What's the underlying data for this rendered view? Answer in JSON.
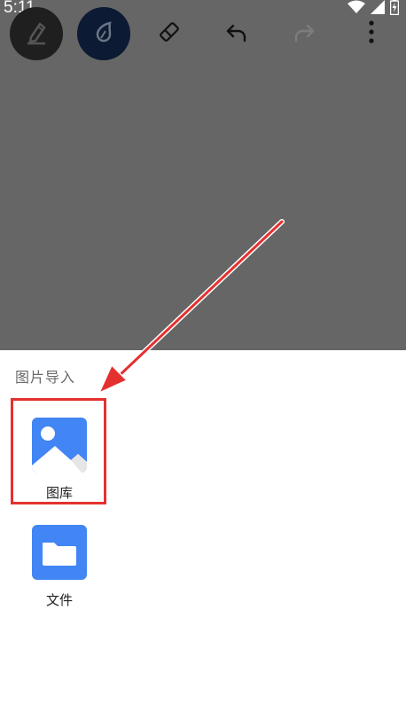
{
  "status_bar": {
    "time": "5:11",
    "icons": [
      "wifi-icon",
      "signal-icon",
      "battery-icon"
    ]
  },
  "toolbar": {
    "tools": [
      {
        "name": "pen-tool",
        "icon": "pen-icon",
        "active": true
      },
      {
        "name": "ink-tool",
        "icon": "ink-drop-icon",
        "active": true
      },
      {
        "name": "eraser-tool",
        "icon": "eraser-icon",
        "active": false
      },
      {
        "name": "undo",
        "icon": "undo-icon",
        "enabled": true
      },
      {
        "name": "redo",
        "icon": "redo-icon",
        "enabled": false
      },
      {
        "name": "more",
        "icon": "more-vertical-icon",
        "enabled": true
      }
    ]
  },
  "sheet": {
    "title": "图片导入",
    "options": [
      {
        "label": "图库",
        "icon": "gallery-icon",
        "highlighted": true
      },
      {
        "label": "文件",
        "icon": "folder-icon",
        "highlighted": false
      }
    ]
  },
  "colors": {
    "canvas_overlay": "#666666",
    "accent_blue": "#4285f4",
    "highlight_red": "#e53030"
  }
}
